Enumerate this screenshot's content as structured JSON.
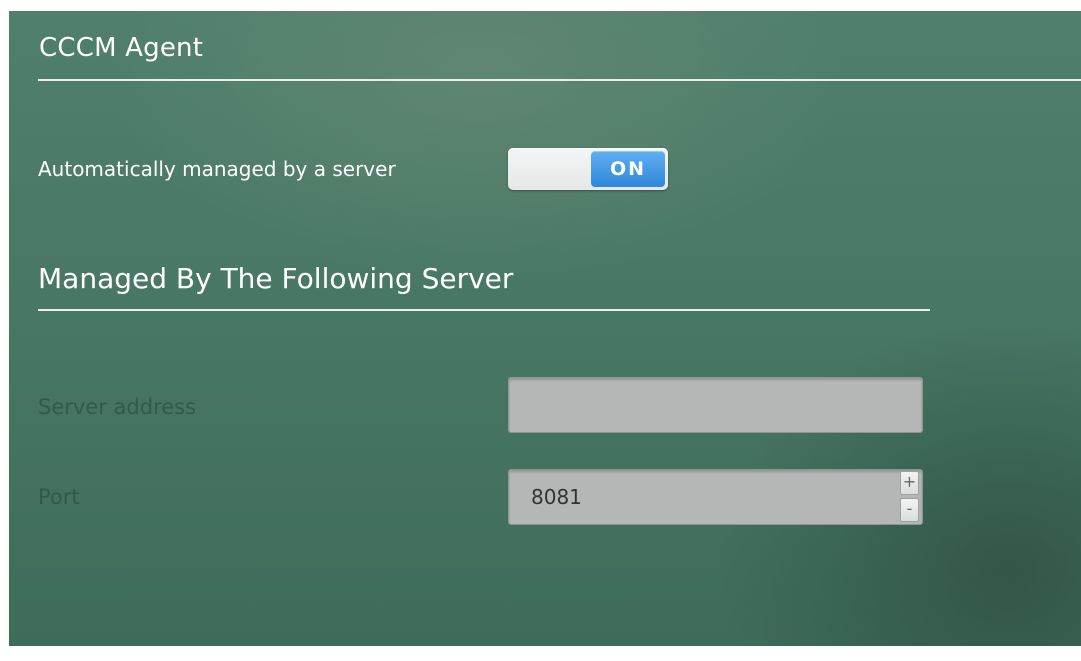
{
  "header": {
    "title": "CCCM Agent"
  },
  "auto_managed": {
    "label": "Automatically managed by a server",
    "toggle_state": "ON",
    "accent_color": "#3d96e6"
  },
  "server_section": {
    "title": "Managed By The Following Server",
    "server_address": {
      "label": "Server address",
      "value": ""
    },
    "port": {
      "label": "Port",
      "value": "8081",
      "increment_label": "+",
      "decrement_label": "-"
    }
  }
}
